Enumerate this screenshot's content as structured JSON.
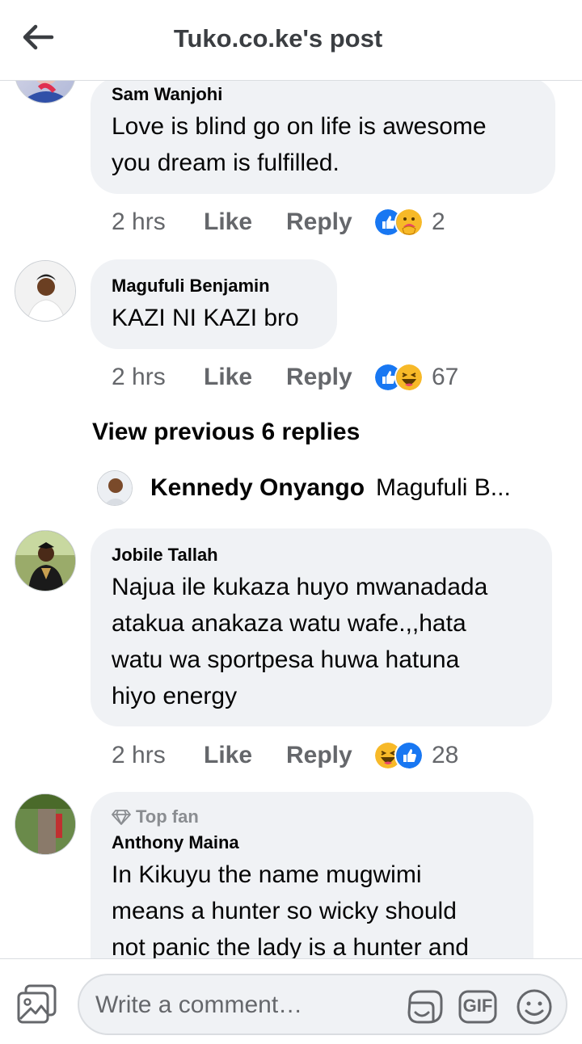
{
  "header": {
    "title": "Tuko.co.ke's post",
    "back_icon": "arrow-left-icon"
  },
  "comments": [
    {
      "name": "Sam Wanjohi",
      "lines": [
        "Love is blind go on life is awesome",
        "you dream is fulfilled."
      ],
      "time": "2 hrs",
      "like": "Like",
      "reply": "Reply",
      "reactions": [
        "like",
        "care"
      ],
      "count": "2"
    },
    {
      "name": "Magufuli Benjamin",
      "lines": [
        "KAZI NI KAZI bro"
      ],
      "time": "2 hrs",
      "like": "Like",
      "reply": "Reply",
      "reactions": [
        "like",
        "haha"
      ],
      "count": "67"
    },
    {
      "name": "Jobile Tallah",
      "lines": [
        "Najua ile kukaza huyo mwanadada",
        "atakua anakaza watu wafe.,,hata",
        "watu wa sportpesa huwa hatuna",
        "hiyo energy"
      ],
      "time": "2 hrs",
      "like": "Like",
      "reply": "Reply",
      "reactions": [
        "haha",
        "like"
      ],
      "count": "28"
    },
    {
      "badge": "Top fan",
      "name": "Anthony Maina",
      "lines": [
        "In Kikuyu the name mugwimi",
        "means a hunter so wicky should",
        "not panic the lady is a hunter and"
      ]
    }
  ],
  "view_previous": "View previous 6 replies",
  "reply_preview": {
    "name": "Kennedy Onyango",
    "text": "Magufuli B..."
  },
  "composer": {
    "placeholder": "Write a comment…",
    "gif_label": "GIF"
  },
  "colors": {
    "like_blue": "#1877f2",
    "haha_yellow": "#f7b928",
    "bubble_bg": "#f0f2f5",
    "muted_text": "#65676b"
  }
}
